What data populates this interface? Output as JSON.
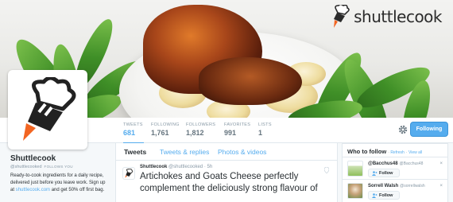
{
  "brand": {
    "name": "shuttlecook"
  },
  "stats": [
    {
      "label": "TWEETS",
      "value": "681"
    },
    {
      "label": "FOLLOWING",
      "value": "1,761"
    },
    {
      "label": "FOLLOWERS",
      "value": "1,812"
    },
    {
      "label": "FAVORITES",
      "value": "991"
    },
    {
      "label": "LISTS",
      "value": "1"
    }
  ],
  "follow_button": "Following",
  "profile": {
    "name": "Shuttlecook",
    "handle": "@shuttlecooked",
    "follows_you": "FOLLOWS YOU",
    "bio_prefix": "Ready-to-cook ingredients for a daily recipe, delivered just before you leave work. Sign up at ",
    "bio_link": "shuttlecook.com",
    "bio_suffix": " and get 50% off first bag."
  },
  "timeline": {
    "tabs": [
      "Tweets",
      "Tweets & replies",
      "Photos & videos"
    ],
    "tweet": {
      "name": "Shuttlecook",
      "handle": "@shuttlecooked",
      "time": "· 5h",
      "text": "Artichokes and Goats Cheese perfectly complement the deliciously strong flavour of"
    }
  },
  "who_to_follow": {
    "title": "Who to follow",
    "refresh": "Refresh",
    "view_all": "View all",
    "suggestions": [
      {
        "name": "@Bacchus48",
        "handle": "@Bacchus48",
        "follow": "Follow"
      },
      {
        "name": "Sorrell Walsh",
        "handle": "@sorrellwalsh",
        "follow": "Follow"
      }
    ]
  },
  "colors": {
    "accent": "#55acee",
    "text": "#292f33",
    "muted": "#8899a6",
    "brand_flame": "#f26522"
  },
  "icons": [
    "shuttlecook-logo-icon",
    "gear-icon",
    "follow-user-icon",
    "location-pin-icon",
    "close-icon"
  ]
}
